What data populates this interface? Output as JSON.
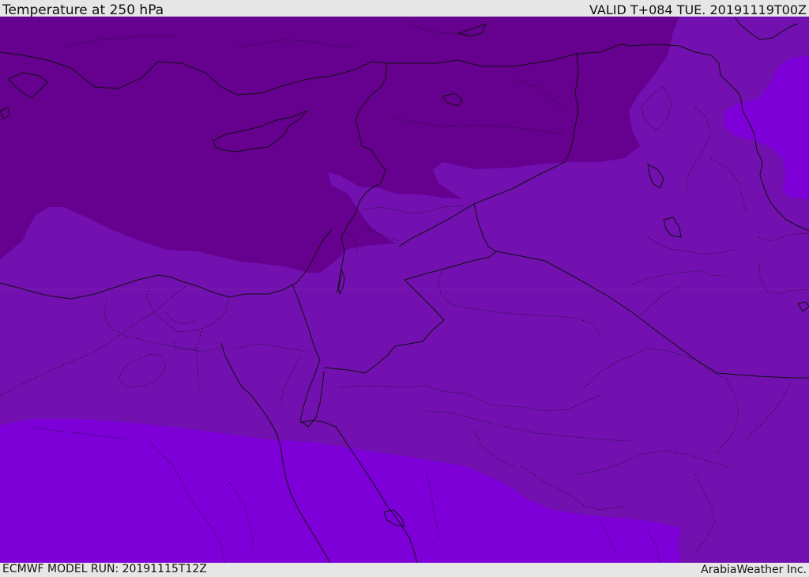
{
  "header": {
    "title": "Temperature at 250 hPa",
    "valid": "VALID T+084 TUE. 20191119T00Z"
  },
  "footer": {
    "model_run": "ECMWF MODEL RUN: 20191115T12Z",
    "credit": "ArabiaWeather Inc."
  },
  "colors": {
    "cold_band": "#66008f",
    "mid_band": "#7210b0",
    "warm_band": "#7d00d8",
    "east_cold_patch": "#6e05a8",
    "boundary_line": "#111111"
  }
}
